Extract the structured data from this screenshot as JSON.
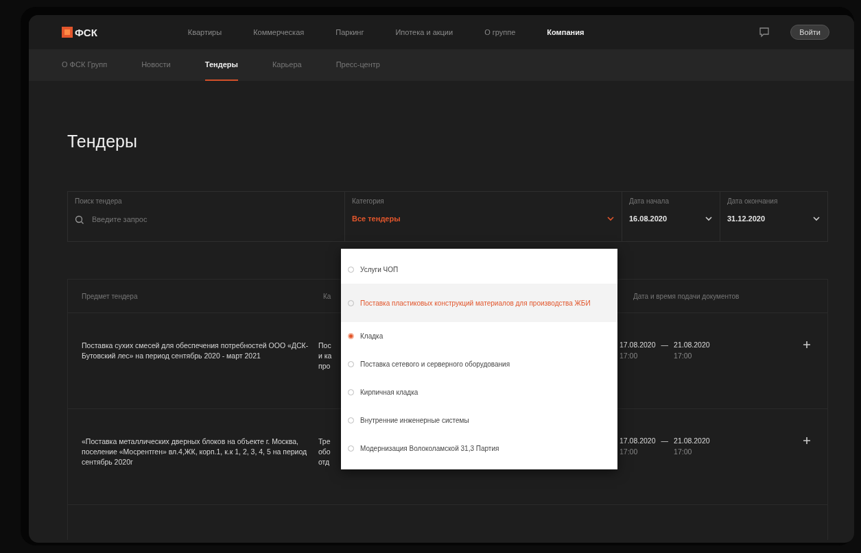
{
  "header": {
    "logo": "ФСК",
    "nav": [
      {
        "label": "Квартиры",
        "selected": false
      },
      {
        "label": "Коммерческая",
        "selected": false
      },
      {
        "label": "Паркинг",
        "selected": false
      },
      {
        "label": "Ипотека и акции",
        "selected": false
      },
      {
        "label": "О группе",
        "selected": false
      },
      {
        "label": "Компания",
        "selected": true
      }
    ],
    "login": "Войти"
  },
  "subnav": [
    {
      "label": "О ФСК Групп",
      "selected": false
    },
    {
      "label": "Новости",
      "selected": false
    },
    {
      "label": "Тендеры",
      "selected": true
    },
    {
      "label": "Карьера",
      "selected": false
    },
    {
      "label": "Пресс-центр",
      "selected": false
    }
  ],
  "title": "Тендеры",
  "filters": {
    "search": {
      "label": "Поиск тендера",
      "placeholder": "Введите запрос"
    },
    "category": {
      "label": "Категория",
      "value": "Все тендеры"
    },
    "start": {
      "label": "Дата начала",
      "value": "16.08.2020"
    },
    "end": {
      "label": "Дата окончания",
      "value": "31.12.2020"
    }
  },
  "table": {
    "columns": [
      "Предмет тендера",
      "Ка",
      "Дата и время подачи документов"
    ],
    "rows": [
      {
        "subject": "Поставка сухих смесей для обеспечения потребностей ООО «ДСК-Бутовский лес» на период сентябрь 2020 - март 2021",
        "column_2": [
          "Пос",
          "и ка",
          "про"
        ],
        "from": "17.08.2020",
        "from_time": "17:00",
        "separator": "—",
        "to": "21.08.2020",
        "to_time": "17:00"
      },
      {
        "subject": "«Поставка металлических дверных блоков на объекте г. Москва, поселение «Мосрентген» вл.4,ЖК, корп.1, к.к 1, 2, 3, 4, 5 на период сентябрь 2020г",
        "column_2": [
          "Тре",
          "обо",
          "отд"
        ],
        "from": "17.08.2020",
        "from_time": "17:00",
        "separator": "—",
        "to": "21.08.2020",
        "to_time": "17:00"
      }
    ]
  },
  "category_menu": [
    {
      "label": "Услуги ЧОП",
      "selected": false,
      "hovered": false
    },
    {
      "label": "Поставка пластиковых конструкций материалов для производства ЖБИ",
      "selected": false,
      "hovered": true
    },
    {
      "label": "Кладка",
      "selected": true,
      "hovered": false
    },
    {
      "label": "Поставка сетевого и серверного оборудования",
      "selected": false,
      "hovered": false
    },
    {
      "label": "Кирпичная кладка",
      "selected": false,
      "hovered": false
    },
    {
      "label": "Внутренние инженерные системы",
      "selected": false,
      "hovered": false
    },
    {
      "label": "Модернизация Волоколамской 31,3 Партия",
      "selected": false,
      "hovered": false
    }
  ]
}
